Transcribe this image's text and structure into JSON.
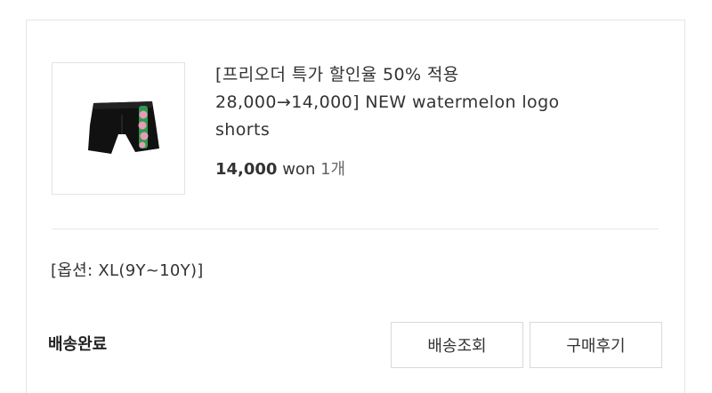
{
  "product": {
    "name_line1": "[프리오더 특가 할인율 50% 적용",
    "name_line2": "28,000→14,000] NEW watermelon logo",
    "name_line3": "shorts",
    "price": "14,000",
    "currency": "won",
    "quantity": "1개",
    "image_alt": "black shorts with watermelon logo print"
  },
  "option": "[옵션: XL(9Y~10Y)]",
  "order": {
    "status": "배송완료",
    "track_button": "배송조회",
    "review_button": "구매후기"
  },
  "colors": {
    "border": "#e5e5e5",
    "text": "#333333",
    "shorts": "#111111",
    "watermelon_green": "#2e9a4e",
    "watermelon_pink": "#e79ab8"
  }
}
